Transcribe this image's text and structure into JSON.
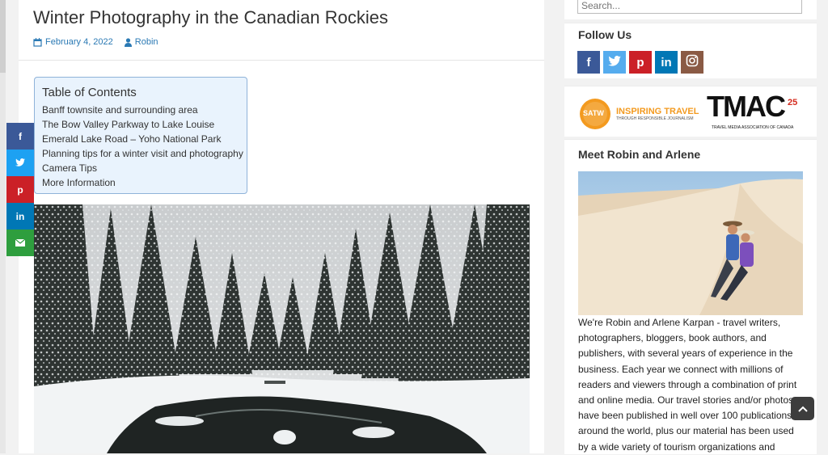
{
  "post": {
    "title": "Winter Photography in the Canadian Rockies",
    "date": "February 4, 2022",
    "author": "Robin"
  },
  "toc": {
    "title": "Table of Contents",
    "items": [
      "Banff townsite and surrounding area",
      "The Bow Valley Parkway to Lake Louise",
      "Emerald Lake Road – Yoho National Park",
      "Planning tips for a winter visit and photography",
      "Camera Tips",
      "More Information"
    ]
  },
  "share": {
    "icons": [
      "facebook-icon",
      "twitter-icon",
      "pinterest-icon",
      "linkedin-icon",
      "email-icon"
    ],
    "colors": [
      "#3b5998",
      "#1da1f2",
      "#cb2027",
      "#0077b5",
      "#2e9e3e"
    ]
  },
  "sidebar": {
    "search_placeholder": "Search...",
    "follow_title": "Follow Us",
    "social_icons": [
      "facebook-icon",
      "twitter-icon",
      "pinterest-icon",
      "linkedin-icon",
      "instagram-icon"
    ],
    "social_colors": [
      "#3b5998",
      "#55acee",
      "#cb2027",
      "#0077b5",
      "#8a5a44"
    ],
    "logos": {
      "satw_text": "SATW",
      "satw_tagline": "INSPIRING TRAVEL",
      "satw_subline": "THROUGH RESPONSIBLE JOURNALISM",
      "tmac_text": "TMAC",
      "tmac_anniv": "25",
      "tmac_subline": "TRAVEL MEDIA ASSOCIATION OF CANADA"
    },
    "meet_title": "Meet Robin and Arlene",
    "bio": "We're Robin and Arlene Karpan - travel writers, photographers, bloggers, book authors, and publishers, with several years of experience in the business. Each year we connect with millions of readers and viewers through a combination of print and online media. Our travel stories and/or photos have been published in well over 100 publications around the world, plus our material has been used by a wide variety of tourism organizations and"
  }
}
